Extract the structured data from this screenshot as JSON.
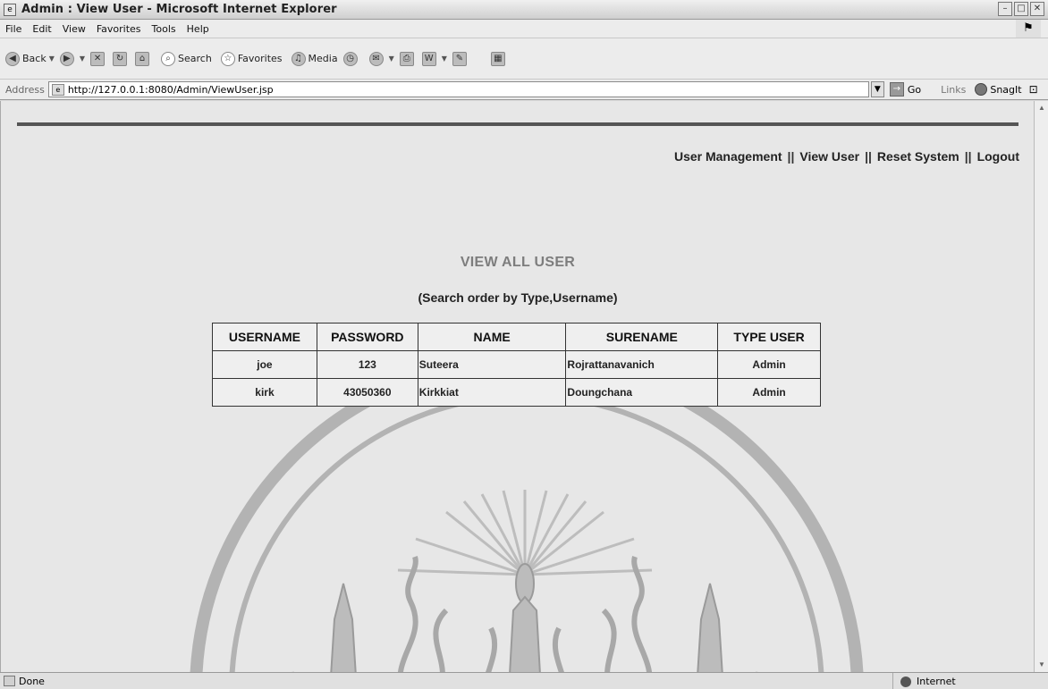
{
  "window": {
    "title": "Admin : View User - Microsoft Internet Explorer",
    "minimize": "–",
    "maximize": "□",
    "close": "✕"
  },
  "menu": {
    "items": [
      "File",
      "Edit",
      "View",
      "Favorites",
      "Tools",
      "Help"
    ]
  },
  "toolbar": {
    "back_label": "Back",
    "search_label": "Search",
    "favorites_label": "Favorites",
    "media_label": "Media"
  },
  "address": {
    "label": "Address",
    "url": "http://127.0.0.1:8080/Admin/ViewUser.jsp",
    "go_label": "Go",
    "links_label": "Links",
    "snagit_label": "SnagIt"
  },
  "nav": {
    "user_management": "User Management",
    "view_user": "View User",
    "reset_system": "Reset System",
    "logout": "Logout",
    "separator": "||"
  },
  "page": {
    "title": "VIEW ALL USER",
    "subtitle": "(Search order by Type,Username)"
  },
  "table": {
    "headers": [
      "USERNAME",
      "PASSWORD",
      "NAME",
      "SURENAME",
      "TYPE USER"
    ],
    "rows": [
      [
        "joe",
        "123",
        "Suteera",
        "Rojrattanavanich",
        "Admin"
      ],
      [
        "kirk",
        "43050360",
        "Kirkkiat",
        "Doungchana",
        "Admin"
      ]
    ]
  },
  "status": {
    "left": "Done",
    "zone": "Internet"
  }
}
